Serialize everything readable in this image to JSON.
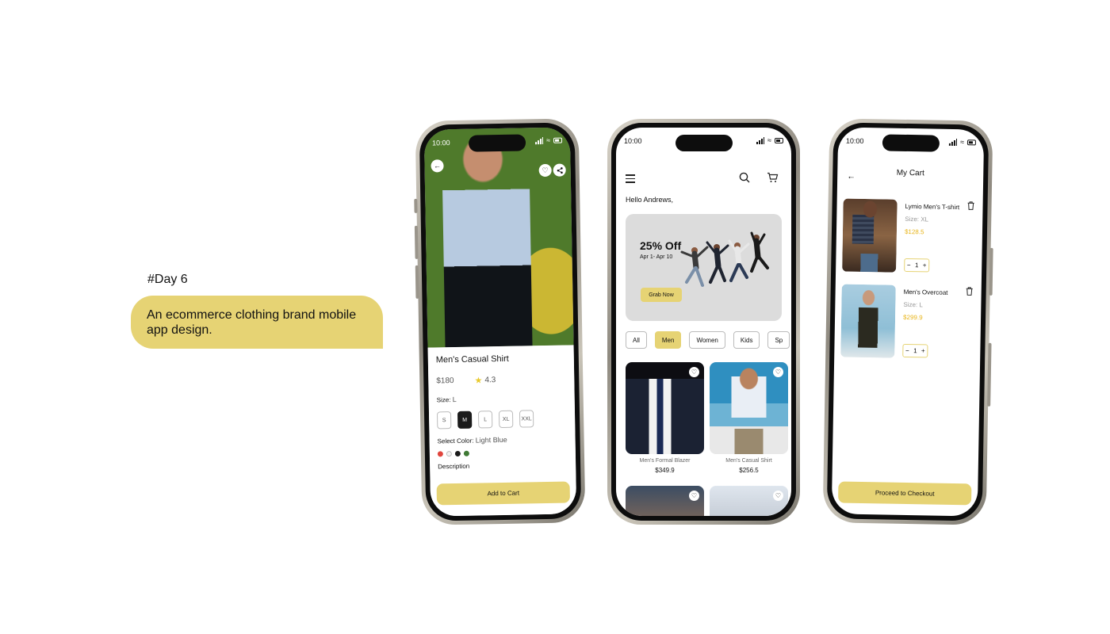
{
  "intro": {
    "day": "#Day 6",
    "description": "An ecommerce clothing brand mobile app design."
  },
  "colors": {
    "accent": "#e6d374",
    "price": "#e8b51a",
    "dark": "#1b1b1b"
  },
  "status": {
    "time": "10:00"
  },
  "detail": {
    "title": "Men's Casual Shirt",
    "price": "$180",
    "rating": "4.3",
    "size_label": "Size:",
    "size_value": "L",
    "sizes": [
      "S",
      "M",
      "L",
      "XL",
      "XXL"
    ],
    "selected_size": "M",
    "color_label": "Select Color:",
    "color_value": "Light Blue",
    "swatches": [
      "#e0453d",
      "#f2f2f2",
      "#1b1b1b",
      "#3f7a35"
    ],
    "description_label": "Description",
    "cta": "Add to Cart"
  },
  "home": {
    "greeting": "Hello Andrews,",
    "banner": {
      "title": "25% Off",
      "dates": "Apr 1- Apr 10",
      "button": "Grab Now"
    },
    "categories": [
      "All",
      "Men",
      "Women",
      "Kids",
      "Sp"
    ],
    "selected_category": "Men",
    "products": [
      {
        "name": "Men's Formal Blazer",
        "price": "$349.9"
      },
      {
        "name": "Men's Casual Shirt",
        "price": "$256.5"
      }
    ]
  },
  "cart": {
    "title": "My Cart",
    "items": [
      {
        "name": "Lymio Men's T-shirt",
        "size": "Size: XL",
        "price": "$128.5",
        "qty": "1"
      },
      {
        "name": "Men's Overcoat",
        "size": "Size: L",
        "price": "$299.9",
        "qty": "1"
      }
    ],
    "cta": "Proceed to Checkout"
  }
}
